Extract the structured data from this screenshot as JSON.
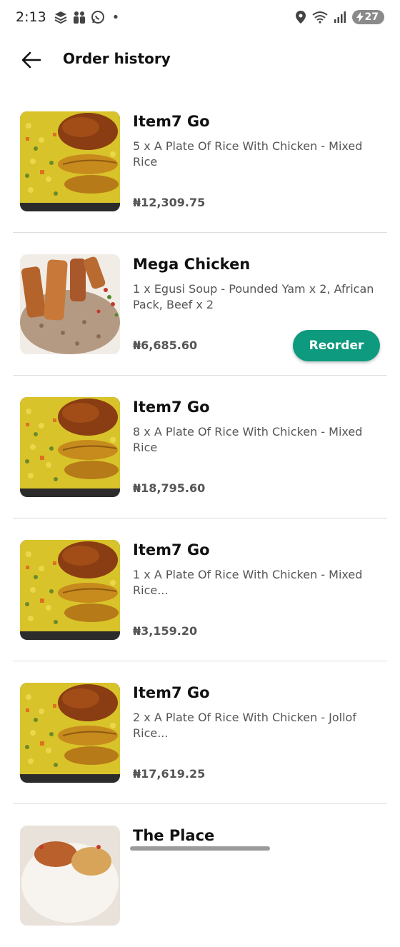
{
  "status_bar": {
    "time": "2:13",
    "battery": "27",
    "dot": "•"
  },
  "header": {
    "title": "Order history",
    "back_icon": "arrow-left-icon"
  },
  "orders": [
    {
      "store": "Item7 Go",
      "description": "5 x A Plate Of Rice With Chicken - Mixed Rice",
      "price": "₦12,309.75",
      "image": "rice-chicken-plantain"
    },
    {
      "store": "Mega Chicken",
      "description": "1 x Egusi Soup - Pounded Yam x 2, African Pack, Beef x 2",
      "price": "₦6,685.60",
      "image": "chicken-strips-rice",
      "reorder_label": "Reorder"
    },
    {
      "store": "Item7 Go",
      "description": "8 x A Plate Of Rice With Chicken - Mixed Rice",
      "price": "₦18,795.60",
      "image": "rice-chicken-plantain"
    },
    {
      "store": "Item7 Go",
      "description": "1 x A Plate Of Rice With Chicken - Mixed Rice...",
      "price": "₦3,159.20",
      "image": "rice-chicken-plantain"
    },
    {
      "store": "Item7 Go",
      "description": "2 x A Plate Of Rice With Chicken - Jollof Rice...",
      "price": "₦17,619.25",
      "image": "rice-chicken-plantain"
    },
    {
      "store": "The Place",
      "image": "plated-food"
    }
  ],
  "colors": {
    "accent": "#0e9a7e",
    "divider": "#dedede",
    "secondary_text": "#555555"
  }
}
